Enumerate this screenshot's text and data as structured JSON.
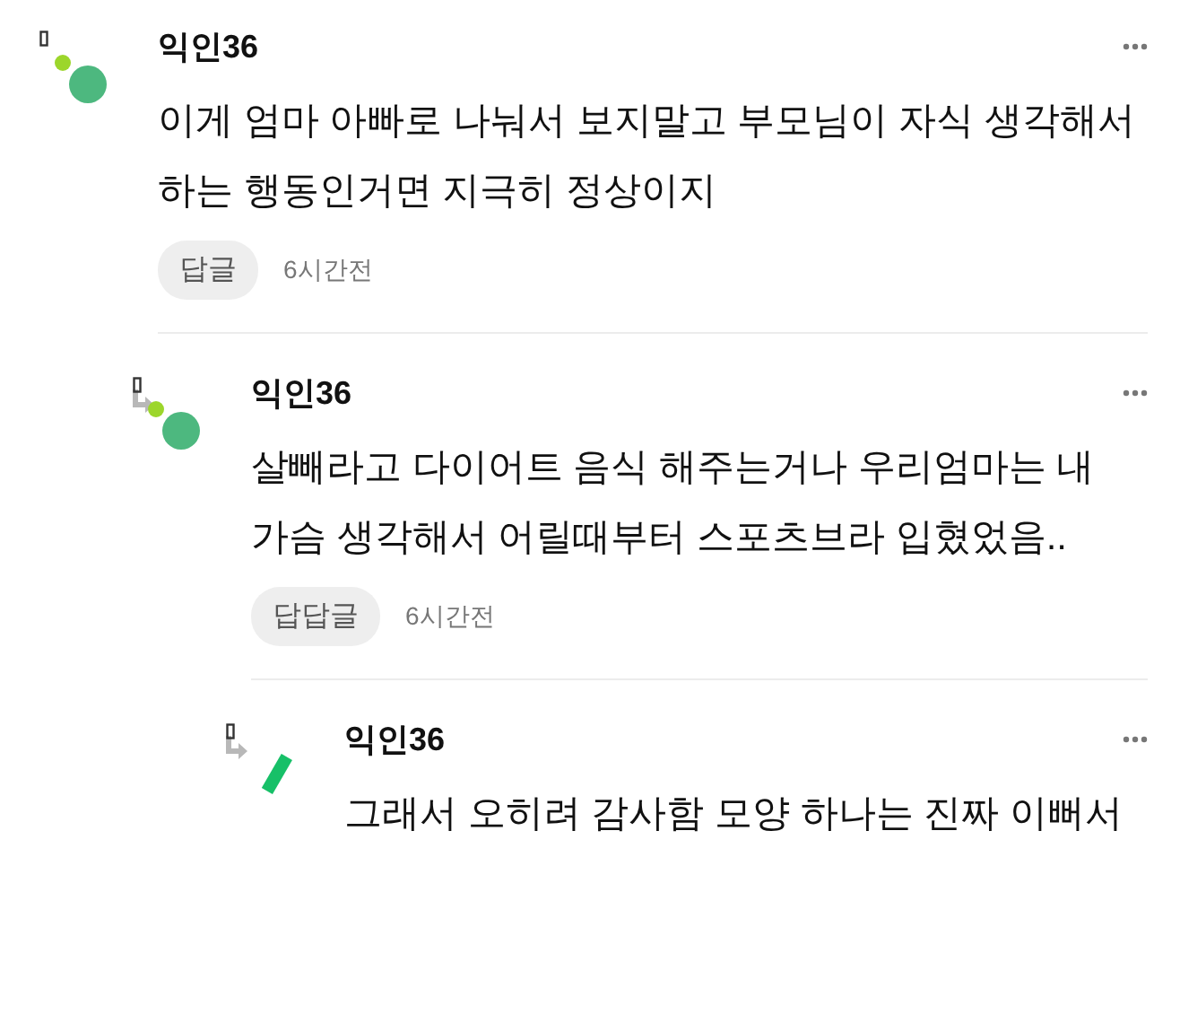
{
  "comments": [
    {
      "author": "익인36",
      "avatar": {
        "kind": "dots"
      },
      "text": "이게 엄마 아빠로 나눠서 보지말고 부모님이 자식 생각해서 하는 행동인거면 지극히 정상이지",
      "reply_button": "답글",
      "time": "6시간전",
      "children": [
        {
          "author": "익인36",
          "avatar": {
            "kind": "dots"
          },
          "text": "살빼라고 다이어트 음식 해주는거나 우리엄마는 내 가슴 생각해서 어릴때부터 스포츠브라 입혔었음..",
          "reply_button": "답답글",
          "time": "6시간전",
          "children": [
            {
              "author": "익인36",
              "avatar": {
                "kind": "bar"
              },
              "text": "그래서 오히려 감사함 모양 하나는 진짜 이뻐서"
            }
          ]
        }
      ]
    }
  ]
}
